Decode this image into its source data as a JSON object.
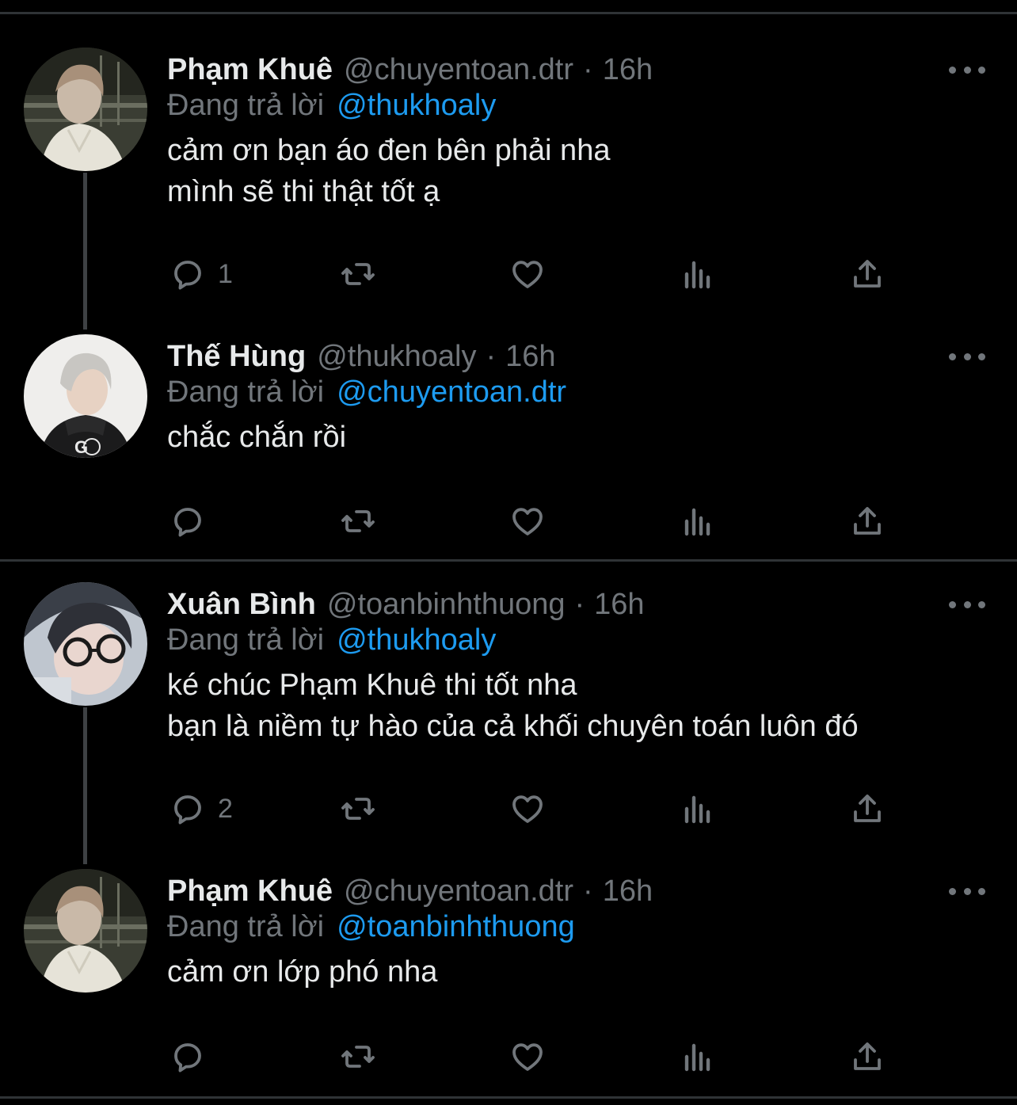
{
  "tweets": [
    {
      "name": "Phạm Khuê",
      "handle": "@chuyentoan.dtr",
      "separator": "·",
      "time": "16h",
      "reply_label": "Đang trả lời",
      "reply_to": "@thukhoaly",
      "lines": [
        "cảm ơn bạn áo đen bên phải nha",
        "mình sẽ thi thật tốt ạ"
      ],
      "reply_count": "1",
      "avatar": "avatar-pham-khue"
    },
    {
      "name": "Thế Hùng",
      "handle": "@thukhoaly",
      "separator": "·",
      "time": "16h",
      "reply_label": "Đang trả lời",
      "reply_to": "@chuyentoan.dtr",
      "lines": [
        "chắc chắn rồi"
      ],
      "reply_count": "",
      "avatar": "avatar-the-hung"
    },
    {
      "name": "Xuân Bình",
      "handle": "@toanbinhthuong",
      "separator": "·",
      "time": "16h",
      "reply_label": "Đang trả lời",
      "reply_to": "@thukhoaly",
      "lines": [
        "ké chúc Phạm Khuê thi tốt nha",
        "bạn là niềm tự hào của cả khối chuyên toán luôn đó"
      ],
      "reply_count": "2",
      "avatar": "avatar-xuan-binh"
    },
    {
      "name": "Phạm Khuê",
      "handle": "@chuyentoan.dtr",
      "separator": "·",
      "time": "16h",
      "reply_label": "Đang trả lời",
      "reply_to": "@toanbinhthuong",
      "lines": [
        "cảm ơn lớp phó nha"
      ],
      "reply_count": "",
      "avatar": "avatar-pham-khue"
    }
  ],
  "icons": {
    "reply": "speech-bubble-icon",
    "retweet": "retweet-icon",
    "like": "heart-icon",
    "views": "bar-chart-icon",
    "share": "share-icon",
    "more": "more-dots-icon"
  },
  "colors": {
    "background": "#000000",
    "text": "#e7e9ea",
    "muted": "#71767b",
    "link": "#1d9bf0",
    "divider": "#2f3336"
  }
}
